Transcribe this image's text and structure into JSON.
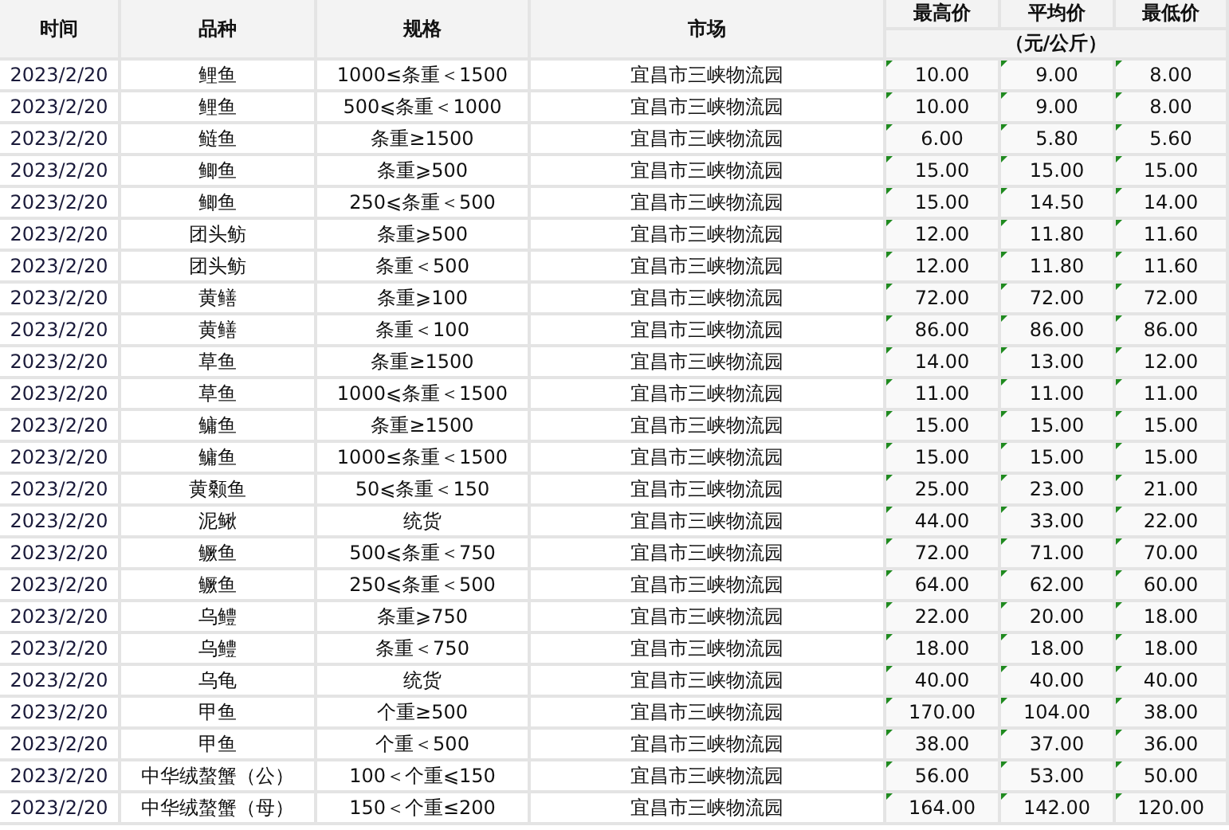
{
  "table": {
    "columns": [
      "时间",
      "品种",
      "规格",
      "市场",
      "最高价",
      "平均价",
      "最低价"
    ],
    "unit": "（元/公斤）",
    "rows": [
      {
        "time": "2023/2/20",
        "variety": "鲤鱼",
        "spec": "1000≤条重＜1500",
        "market": "宜昌市三峡物流园",
        "max": "10.00",
        "avg": "9.00",
        "min": "8.00"
      },
      {
        "time": "2023/2/20",
        "variety": "鲤鱼",
        "spec": "500⩽条重＜1000",
        "market": "宜昌市三峡物流园",
        "max": "10.00",
        "avg": "9.00",
        "min": "8.00"
      },
      {
        "time": "2023/2/20",
        "variety": "鲢鱼",
        "spec": "条重≥1500",
        "market": "宜昌市三峡物流园",
        "max": "6.00",
        "avg": "5.80",
        "min": "5.60"
      },
      {
        "time": "2023/2/20",
        "variety": "鲫鱼",
        "spec": "条重⩾500",
        "market": "宜昌市三峡物流园",
        "max": "15.00",
        "avg": "15.00",
        "min": "15.00"
      },
      {
        "time": "2023/2/20",
        "variety": "鲫鱼",
        "spec": "250⩽条重＜500",
        "market": "宜昌市三峡物流园",
        "max": "15.00",
        "avg": "14.50",
        "min": "14.00"
      },
      {
        "time": "2023/2/20",
        "variety": "团头鲂",
        "spec": "条重⩾500",
        "market": "宜昌市三峡物流园",
        "max": "12.00",
        "avg": "11.80",
        "min": "11.60"
      },
      {
        "time": "2023/2/20",
        "variety": "团头鲂",
        "spec": "条重＜500",
        "market": "宜昌市三峡物流园",
        "max": "12.00",
        "avg": "11.80",
        "min": "11.60"
      },
      {
        "time": "2023/2/20",
        "variety": "黄鳝",
        "spec": "条重⩾100",
        "market": "宜昌市三峡物流园",
        "max": "72.00",
        "avg": "72.00",
        "min": "72.00"
      },
      {
        "time": "2023/2/20",
        "variety": "黄鳝",
        "spec": "条重＜100",
        "market": "宜昌市三峡物流园",
        "max": "86.00",
        "avg": "86.00",
        "min": "86.00"
      },
      {
        "time": "2023/2/20",
        "variety": "草鱼",
        "spec": "条重≥1500",
        "market": "宜昌市三峡物流园",
        "max": "14.00",
        "avg": "13.00",
        "min": "12.00"
      },
      {
        "time": "2023/2/20",
        "variety": "草鱼",
        "spec": "1000⩽条重＜1500",
        "market": "宜昌市三峡物流园",
        "max": "11.00",
        "avg": "11.00",
        "min": "11.00"
      },
      {
        "time": "2023/2/20",
        "variety": "鳙鱼",
        "spec": "条重≥1500",
        "market": "宜昌市三峡物流园",
        "max": "15.00",
        "avg": "15.00",
        "min": "15.00"
      },
      {
        "time": "2023/2/20",
        "variety": "鳙鱼",
        "spec": "1000≤条重＜1500",
        "market": "宜昌市三峡物流园",
        "max": "15.00",
        "avg": "15.00",
        "min": "15.00"
      },
      {
        "time": "2023/2/20",
        "variety": "黄颡鱼",
        "spec": "50⩽条重＜150",
        "market": "宜昌市三峡物流园",
        "max": "25.00",
        "avg": "23.00",
        "min": "21.00"
      },
      {
        "time": "2023/2/20",
        "variety": "泥鳅",
        "spec": "统货",
        "market": "宜昌市三峡物流园",
        "max": "44.00",
        "avg": "33.00",
        "min": "22.00"
      },
      {
        "time": "2023/2/20",
        "variety": "鳜鱼",
        "spec": "500⩽条重＜750",
        "market": "宜昌市三峡物流园",
        "max": "72.00",
        "avg": "71.00",
        "min": "70.00"
      },
      {
        "time": "2023/2/20",
        "variety": "鳜鱼",
        "spec": "250⩽条重＜500",
        "market": "宜昌市三峡物流园",
        "max": "64.00",
        "avg": "62.00",
        "min": "60.00"
      },
      {
        "time": "2023/2/20",
        "variety": "乌鳢",
        "spec": "条重⩾750",
        "market": "宜昌市三峡物流园",
        "max": "22.00",
        "avg": "20.00",
        "min": "18.00"
      },
      {
        "time": "2023/2/20",
        "variety": "乌鳢",
        "spec": "条重＜750",
        "market": "宜昌市三峡物流园",
        "max": "18.00",
        "avg": "18.00",
        "min": "18.00"
      },
      {
        "time": "2023/2/20",
        "variety": "乌龟",
        "spec": "统货",
        "market": "宜昌市三峡物流园",
        "max": "40.00",
        "avg": "40.00",
        "min": "40.00"
      },
      {
        "time": "2023/2/20",
        "variety": "甲鱼",
        "spec": "个重≥500",
        "market": "宜昌市三峡物流园",
        "max": "170.00",
        "avg": "104.00",
        "min": "38.00"
      },
      {
        "time": "2023/2/20",
        "variety": "甲鱼",
        "spec": "个重＜500",
        "market": "宜昌市三峡物流园",
        "max": "38.00",
        "avg": "37.00",
        "min": "36.00"
      },
      {
        "time": "2023/2/20",
        "variety": "中华绒螯蟹（公）",
        "spec": "100＜个重⩽150",
        "market": "宜昌市三峡物流园",
        "max": "56.00",
        "avg": "53.00",
        "min": "50.00"
      },
      {
        "time": "2023/2/20",
        "variety": "中华绒螯蟹（母）",
        "spec": "150＜个重≤200",
        "market": "宜昌市三峡物流园",
        "max": "164.00",
        "avg": "142.00",
        "min": "120.00"
      }
    ]
  }
}
